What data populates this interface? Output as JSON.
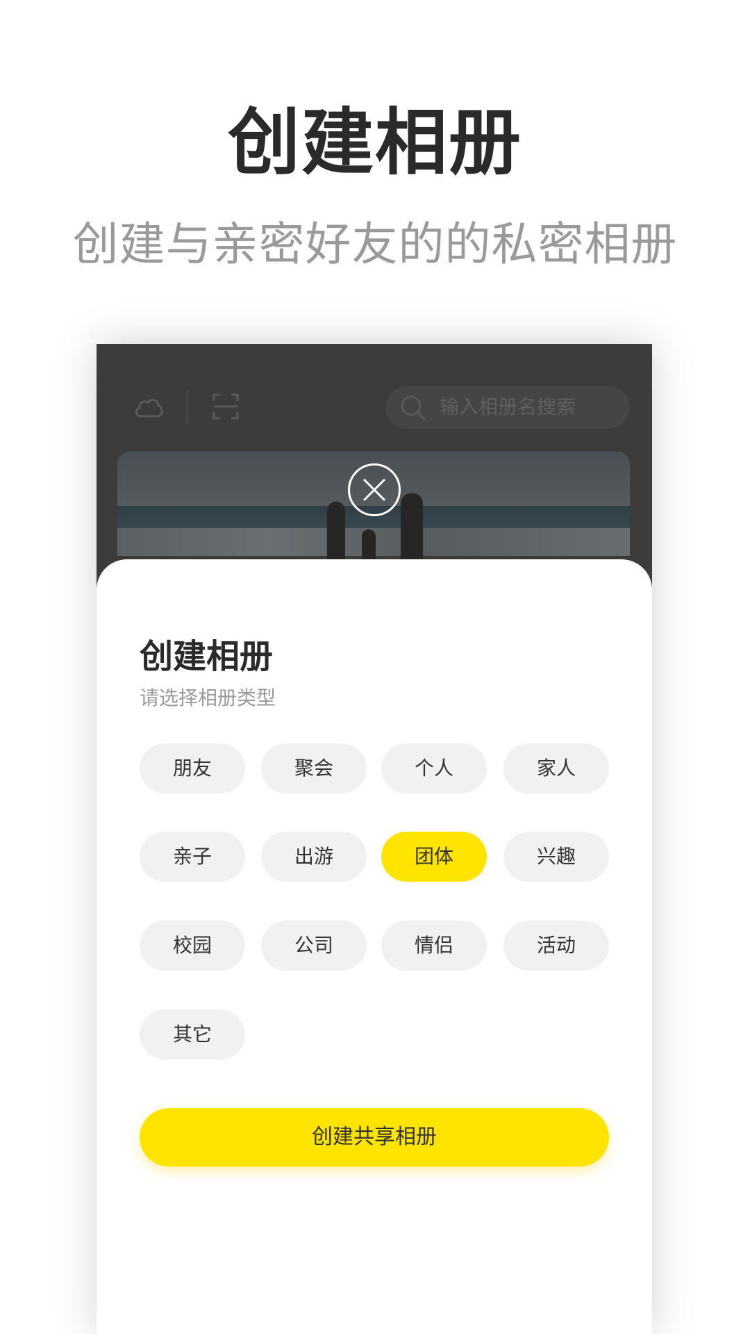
{
  "hero": {
    "title": "创建相册",
    "subtitle": "创建与亲密好友的的私密相册"
  },
  "app": {
    "toolbar": {
      "cloud_icon": "cloud-icon",
      "scan_icon": "scan-icon",
      "search_placeholder": "输入相册名搜索"
    }
  },
  "sheet": {
    "title": "创建相册",
    "subtitle": "请选择相册类型",
    "types": [
      "朋友",
      "聚会",
      "个人",
      "家人",
      "亲子",
      "出游",
      "团体",
      "兴趣",
      "校园",
      "公司",
      "情侣",
      "活动",
      "其它"
    ],
    "selected_type": "团体",
    "create_button": "创建共享相册"
  },
  "colors": {
    "accent": "#ffe400",
    "chip_bg": "#f1f1f1",
    "overlay_bg": "#3c3c3c"
  }
}
